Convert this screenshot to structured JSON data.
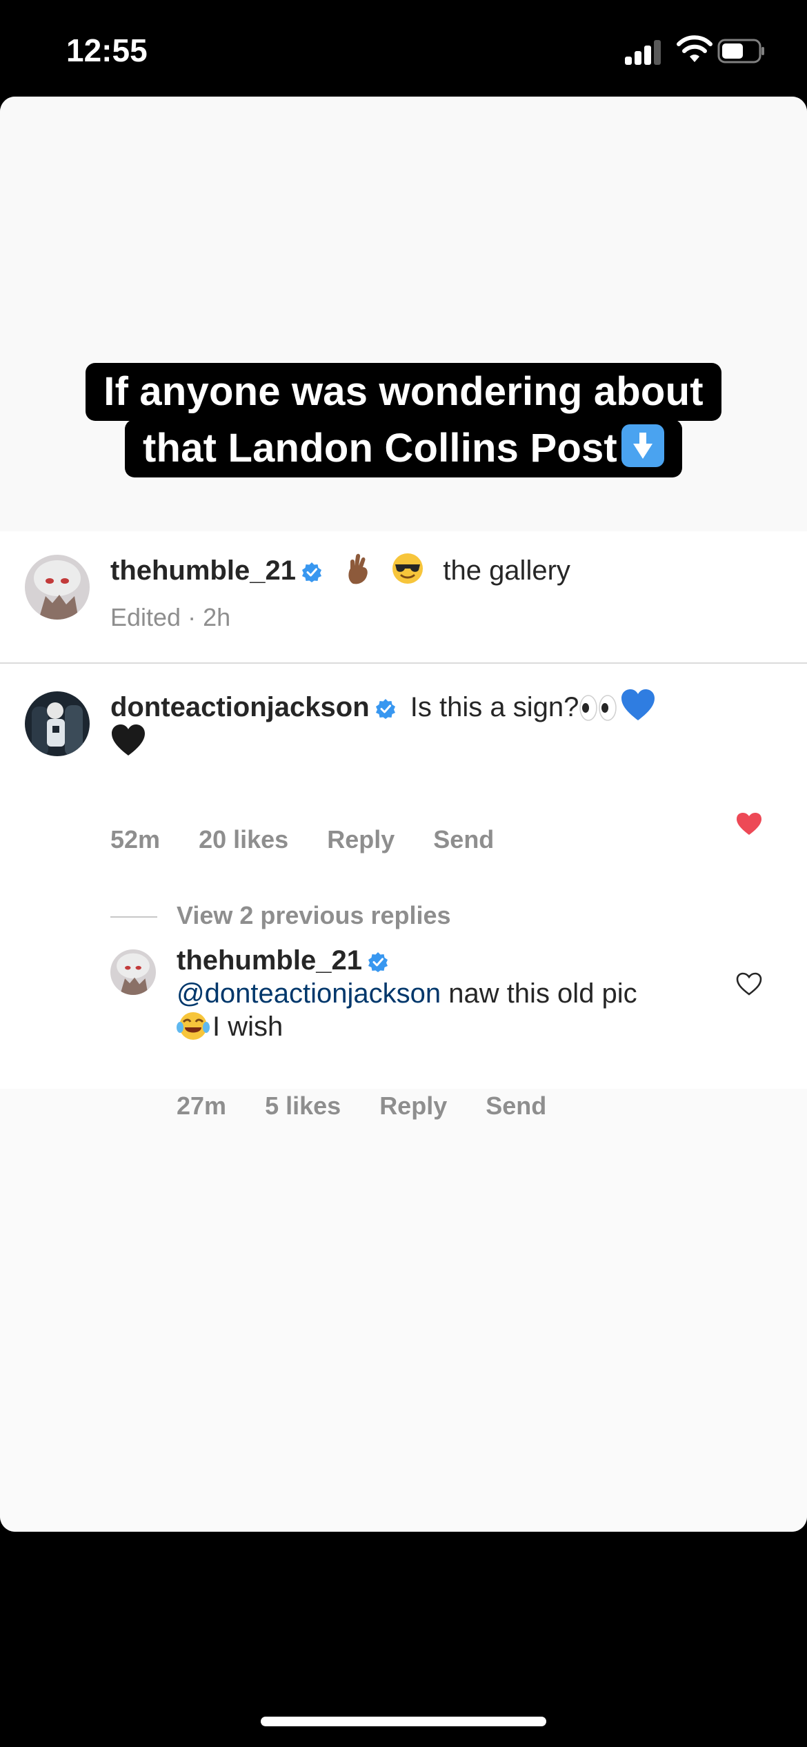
{
  "status_bar": {
    "time": "12:55"
  },
  "story": {
    "caption_line1": "If anyone was wondering about",
    "caption_line2": "that Landon Collins Post"
  },
  "post": {
    "username": "thehumble_21",
    "caption_text": "the gallery",
    "edited_time": "Edited · 2h"
  },
  "comments": [
    {
      "username": "donteactionjackson",
      "text": "Is this a sign?",
      "time": "52m",
      "likes": "20 likes",
      "reply": "Reply",
      "send": "Send",
      "liked": true
    }
  ],
  "view_replies": "View 2 previous replies",
  "reply": {
    "username": "thehumble_21",
    "mention": "@donteactionjackson",
    "text_a": "naw this old pic",
    "text_b": "I wish",
    "time": "27m",
    "likes": "5 likes",
    "reply": "Reply",
    "send": "Send",
    "liked": false
  },
  "colors": {
    "verified": "#3897f0",
    "heart_liked": "#ed4956",
    "mention": "#00376b"
  }
}
